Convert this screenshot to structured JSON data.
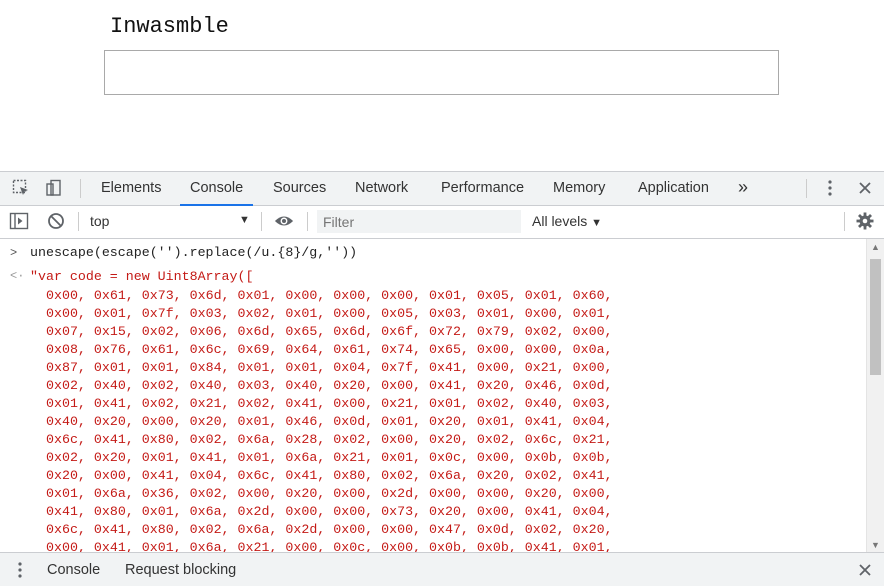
{
  "page": {
    "title": "Inwasmble",
    "input_value": ""
  },
  "devtools": {
    "tabs": [
      "Elements",
      "Console",
      "Sources",
      "Network",
      "Performance",
      "Memory",
      "Application"
    ],
    "active_tab": "Console",
    "more_tabs_glyph": "»",
    "context": "top",
    "filter_placeholder": "Filter",
    "levels_label": "All levels",
    "command": "unescape(escape('').replace(/u.{8}/g,''))",
    "result_head": "\"var code = new Uint8Array([",
    "result_lines": [
      "0x00, 0x61, 0x73, 0x6d, 0x01, 0x00, 0x00, 0x00, 0x01, 0x05, 0x01, 0x60,",
      "0x00, 0x01, 0x7f, 0x03, 0x02, 0x01, 0x00, 0x05, 0x03, 0x01, 0x00, 0x01,",
      "0x07, 0x15, 0x02, 0x06, 0x6d, 0x65, 0x6d, 0x6f, 0x72, 0x79, 0x02, 0x00,",
      "0x08, 0x76, 0x61, 0x6c, 0x69, 0x64, 0x61, 0x74, 0x65, 0x00, 0x00, 0x0a,",
      "0x87, 0x01, 0x01, 0x84, 0x01, 0x01, 0x04, 0x7f, 0x41, 0x00, 0x21, 0x00,",
      "0x02, 0x40, 0x02, 0x40, 0x03, 0x40, 0x20, 0x00, 0x41, 0x20, 0x46, 0x0d,",
      "0x01, 0x41, 0x02, 0x21, 0x02, 0x41, 0x00, 0x21, 0x01, 0x02, 0x40, 0x03,",
      "0x40, 0x20, 0x00, 0x20, 0x01, 0x46, 0x0d, 0x01, 0x20, 0x01, 0x41, 0x04,",
      "0x6c, 0x41, 0x80, 0x02, 0x6a, 0x28, 0x02, 0x00, 0x20, 0x02, 0x6c, 0x21,",
      "0x02, 0x20, 0x01, 0x41, 0x01, 0x6a, 0x21, 0x01, 0x0c, 0x00, 0x0b, 0x0b,",
      "0x20, 0x00, 0x41, 0x04, 0x6c, 0x41, 0x80, 0x02, 0x6a, 0x20, 0x02, 0x41,",
      "0x01, 0x6a, 0x36, 0x02, 0x00, 0x20, 0x00, 0x2d, 0x00, 0x00, 0x20, 0x00,",
      "0x41, 0x80, 0x01, 0x6a, 0x2d, 0x00, 0x00, 0x73, 0x20, 0x00, 0x41, 0x04,",
      "0x6c, 0x41, 0x80, 0x02, 0x6a, 0x2d, 0x00, 0x00, 0x47, 0x0d, 0x02, 0x20,",
      "0x00, 0x41, 0x01, 0x6a, 0x21, 0x00, 0x0c, 0x00, 0x0b, 0x0b, 0x41, 0x01,"
    ],
    "drawer_tabs": [
      "Console",
      "Request blocking"
    ]
  }
}
